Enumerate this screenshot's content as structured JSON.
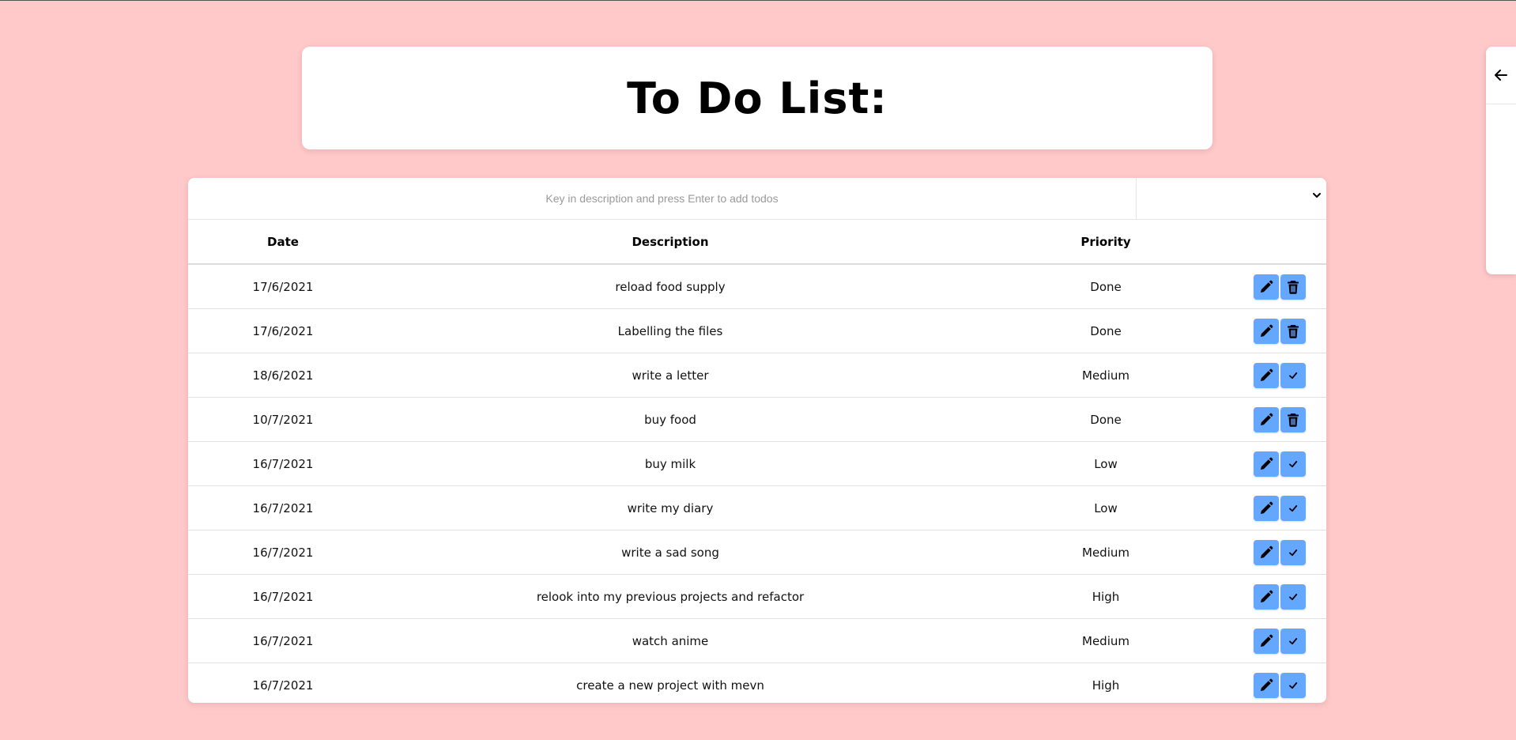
{
  "title": "To Do List:",
  "input": {
    "placeholder": "Key in description and press Enter to add todos",
    "value": ""
  },
  "priority_select": {
    "selected": ""
  },
  "headers": {
    "date": "Date",
    "description": "Description",
    "priority": "Priority"
  },
  "rows": [
    {
      "date": "17/6/2021",
      "description": "reload food supply",
      "priority": "Done",
      "action": "delete"
    },
    {
      "date": "17/6/2021",
      "description": "Labelling the files",
      "priority": "Done",
      "action": "delete"
    },
    {
      "date": "18/6/2021",
      "description": "write a letter",
      "priority": "Medium",
      "action": "complete"
    },
    {
      "date": "10/7/2021",
      "description": "buy food",
      "priority": "Done",
      "action": "delete"
    },
    {
      "date": "16/7/2021",
      "description": "buy milk",
      "priority": "Low",
      "action": "complete"
    },
    {
      "date": "16/7/2021",
      "description": "write my diary",
      "priority": "Low",
      "action": "complete"
    },
    {
      "date": "16/7/2021",
      "description": "write a sad song",
      "priority": "Medium",
      "action": "complete"
    },
    {
      "date": "16/7/2021",
      "description": "relook into my previous projects and refactor",
      "priority": "High",
      "action": "complete"
    },
    {
      "date": "16/7/2021",
      "description": "watch anime",
      "priority": "Medium",
      "action": "complete"
    },
    {
      "date": "16/7/2021",
      "description": "create a new project with mevn",
      "priority": "High",
      "action": "complete"
    }
  ],
  "icons": {
    "edit": "pencil-icon",
    "delete": "trash-icon",
    "complete": "check-icon",
    "back": "arrow-left-icon",
    "dropdown": "chevron-down-icon"
  },
  "colors": {
    "background": "#ffc8c9",
    "button": "#64a7ff",
    "card": "#ffffff"
  }
}
